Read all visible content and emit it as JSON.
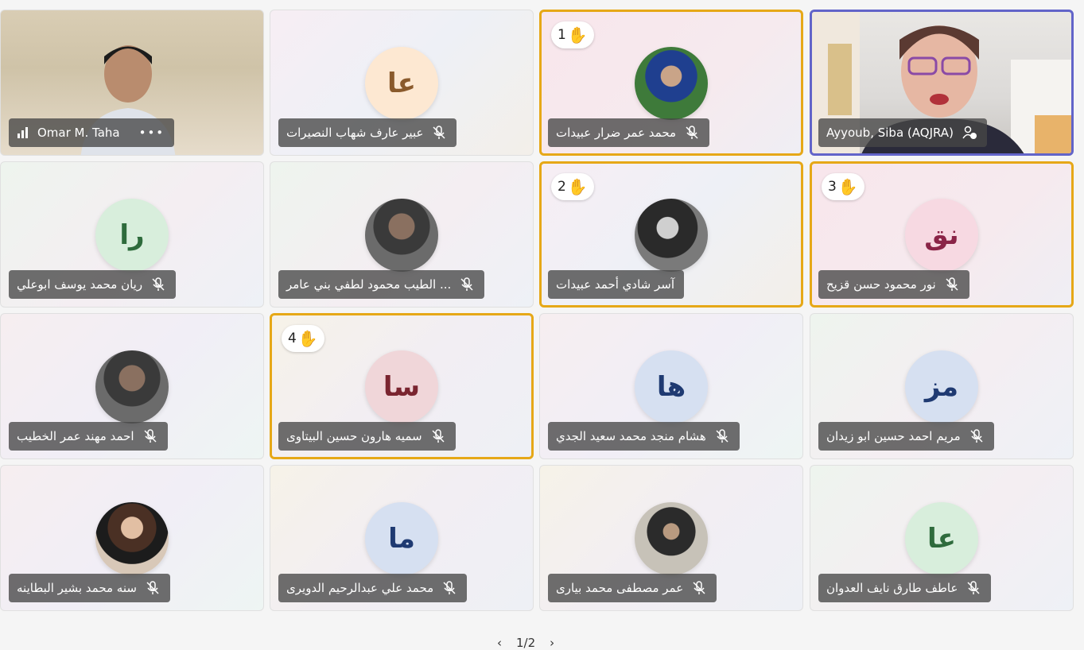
{
  "tiles": [
    {
      "id": "omar",
      "name": "Omar M. Taha",
      "type": "video"
    },
    {
      "id": "abeer",
      "name": "عبير عارف شهاب النصيرات",
      "initials": "عا",
      "avatar_bg": "#fde8d2",
      "avatar_fg": "#8a5a2c"
    },
    {
      "id": "mohammad-omar",
      "name": "محمد عمر ضرار عبيدات",
      "hand": "1"
    },
    {
      "id": "siba",
      "name": "Ayyoub, Siba (AQJRA)",
      "type": "video"
    },
    {
      "id": "rayan",
      "name": "ريان محمد يوسف ابوعلي",
      "initials": "را",
      "avatar_bg": "#d8eedc",
      "avatar_fg": "#2e6b3c"
    },
    {
      "id": "tayeb",
      "name": "... الطيب محمود لطفي بني عامر"
    },
    {
      "id": "aser",
      "name": "آسر شادي أحمد عبيدات",
      "hand": "2"
    },
    {
      "id": "noor",
      "name": "نور محمود حسن قزيح",
      "hand": "3",
      "initials": "نق",
      "avatar_bg": "#f7d9e2",
      "avatar_fg": "#8a2447"
    },
    {
      "id": "ahmad",
      "name": "احمد مهند عمر الخطيب"
    },
    {
      "id": "somaya",
      "name": "سميه هارون حسين البيتاوى",
      "hand": "4",
      "initials": "سا",
      "avatar_bg": "#f0d6d9",
      "avatar_fg": "#7a2530"
    },
    {
      "id": "hisham",
      "name": "هشام منجد محمد سعيد الجدي",
      "initials": "ها",
      "avatar_bg": "#d6e0f1",
      "avatar_fg": "#1f3a72"
    },
    {
      "id": "mariam",
      "name": "مريم احمد حسين ابو زيدان",
      "initials": "مز",
      "avatar_bg": "#d6e0f1",
      "avatar_fg": "#1f3a72"
    },
    {
      "id": "sana",
      "name": "سنه محمد بشير البطاينه"
    },
    {
      "id": "mohammad-ali",
      "name": "محمد علي عبدالرحيم الدويرى",
      "initials": "ما",
      "avatar_bg": "#d6e0f1",
      "avatar_fg": "#1f3a72"
    },
    {
      "id": "omar-mustafa",
      "name": "عمر مصطفى محمد بيارى"
    },
    {
      "id": "atef",
      "name": "عاطف طارق نايف العدوان",
      "initials": "عا",
      "avatar_bg": "#d8eedc",
      "avatar_fg": "#2e6b3c"
    }
  ],
  "pager": {
    "prev": "‹",
    "label": "1/2",
    "next": "›"
  },
  "colors": {
    "hand_border": "#e6a817",
    "speaking_border": "#6264c9"
  }
}
